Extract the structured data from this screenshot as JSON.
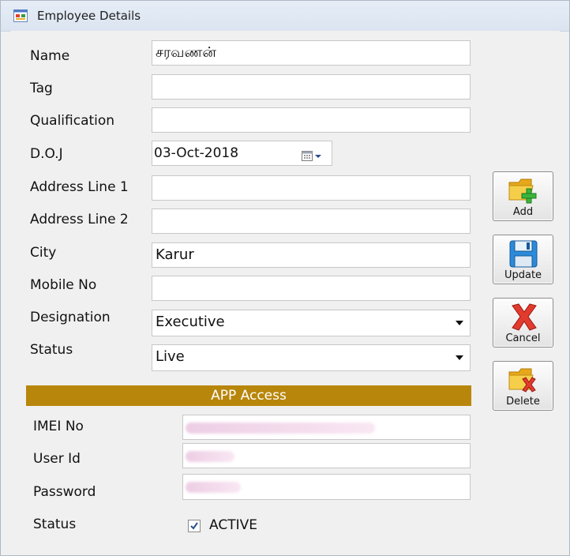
{
  "window": {
    "title": "Employee Details",
    "icon": "form-icon"
  },
  "form": {
    "labels": {
      "name": "Name",
      "tag": "Tag",
      "qualification": "Qualification",
      "doj": "D.O.J",
      "address1": "Address Line 1",
      "address2": "Address Line 2",
      "city": "City",
      "mobile": "Mobile No",
      "designation": "Designation",
      "status": "Status"
    },
    "values": {
      "name": "சரவணன்",
      "tag": "",
      "qualification": "",
      "doj": "03-Oct-2018",
      "address1": "",
      "address2": "",
      "city": "Karur",
      "mobile": "",
      "designation": "Executive",
      "status": "Live"
    }
  },
  "app_access": {
    "header": "APP Access",
    "labels": {
      "imei": "IMEI No",
      "user_id": "User Id",
      "password": "Password",
      "status": "Status"
    },
    "active_label": "ACTIVE",
    "active_checked": true
  },
  "buttons": {
    "add": "Add",
    "update": "Update",
    "cancel": "Cancel",
    "delete": "Delete"
  },
  "colors": {
    "band": "#b8860b",
    "window_bg": "#f0f0f0",
    "titlebar": "#dbe4f0"
  }
}
